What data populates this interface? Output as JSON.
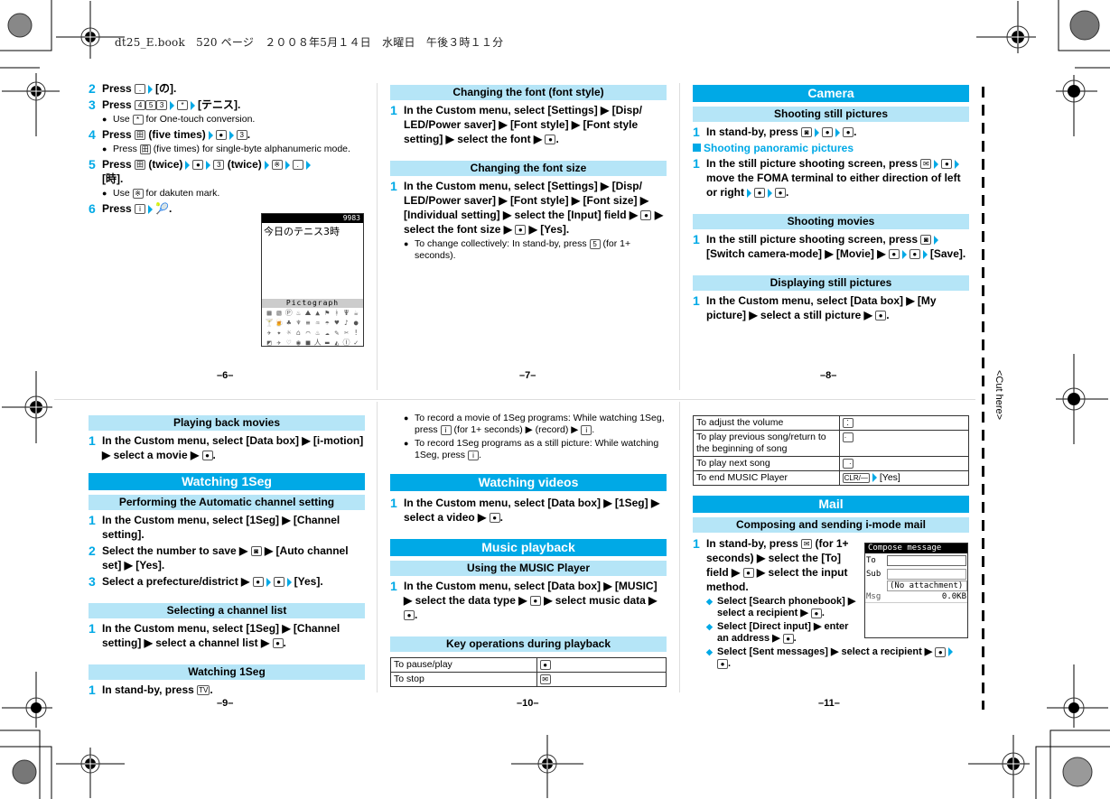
{
  "header": {
    "book_line": "dt25_E.book　520 ページ　２００８年5月１４日　水曜日　午後３時１１分"
  },
  "cut_label": "<Cut here>",
  "pages": {
    "p6": {
      "number": "–6–",
      "steps": [
        {
          "num": "2",
          "parts": [
            "Press ",
            "[.]",
            " ▶ ",
            "[の]."
          ]
        },
        {
          "num": "3",
          "parts": [
            "Press ",
            "[4][5][3]",
            " ▶ ",
            "[*]",
            " ▶ ",
            "[テニス]."
          ]
        },
        {
          "num": "4",
          "parts": [
            "Press ",
            "[田]",
            " (five times) ▶ ",
            "[●]",
            " ▶ ",
            "[3]."
          ]
        },
        {
          "num": "5",
          "parts": [
            "Press ",
            "[田]",
            " (twice) ▶ ",
            "[●]",
            " ▶ ",
            "[3]",
            " (twice) ▶ ",
            "[※]",
            " ▶ ",
            "[.]",
            " ▶ [時]."
          ]
        },
        {
          "num": "6",
          "parts": [
            "Press ",
            "[i]",
            " ▶ ",
            "🎾",
            "."
          ]
        }
      ],
      "step2": "Press",
      "step2_tail": "[の].",
      "step3": "Press",
      "step3_tail": "[テニス].",
      "step3_note": "Use",
      "step3_note_tail": "for One-touch conversion.",
      "step4": "Press",
      "step4_mid": "(five times)",
      "step4_note": "Press",
      "step4_note_tail": "(five times) for single-byte alphanumeric mode.",
      "step5": "Press",
      "step5_mid1": "(twice)",
      "step5_mid2": "(twice)",
      "step5_tail": "[時].",
      "step5_note": "Use",
      "step5_note_tail": "for dakuten mark.",
      "step6": "Press",
      "screen": {
        "counter": "9983",
        "text": "今日のテニス3時",
        "picto_title": "Pictograph"
      }
    },
    "p7": {
      "number": "–7–",
      "sec1_title": "Changing the font (font style)",
      "sec1_step": "In the Custom menu, select [Settings] ▶ [Disp/ LED/Power saver] ▶ [Font style] ▶ [Font style setting] ▶ select the font ▶",
      "sec2_title": "Changing the font size",
      "sec2_step": "In the Custom menu, select [Settings] ▶ [Disp/ LED/Power saver] ▶ [Font style] ▶ [Font size] ▶ [Individual setting] ▶ select the [Input] field ▶",
      "sec2_step_tail1": "▶ select the font size ▶",
      "sec2_step_tail2": "▶ [Yes].",
      "sec2_note": "To change collectively: In stand-by, press",
      "sec2_note_tail": "(for 1+ seconds)."
    },
    "p8": {
      "number": "–8–",
      "main_title": "Camera",
      "sec1_title": "Shooting still pictures",
      "sec1_step": "In stand-by, press",
      "pano_head": "Shooting panoramic pictures",
      "pano_step": "In the still picture shooting screen, press",
      "pano_step_mid": "move the FOMA terminal to either direction of left or right",
      "sec2_title": "Shooting movies",
      "sec2_step": "In the still picture shooting screen, press",
      "sec2_step_mid": "[Switch camera-mode] ▶ [Movie] ▶",
      "sec2_step_tail": "[Save].",
      "sec3_title": "Displaying still pictures",
      "sec3_step": "In the Custom menu, select [Data box] ▶ [My picture] ▶ select a still picture ▶"
    },
    "p9": {
      "number": "–9–",
      "sec1_title": "Playing back movies",
      "sec1_step": "In the Custom menu, select [Data box] ▶ [i-motion] ▶ select a movie ▶",
      "main_title": "Watching 1Seg",
      "sec2_title": "Performing the Automatic channel setting",
      "sec2_step1": "In the Custom menu, select [1Seg] ▶ [Channel setting].",
      "sec2_step2": "Select the number to save ▶",
      "sec2_step2_tail": "▶ [Auto channel set] ▶ [Yes].",
      "sec2_step3": "Select a prefecture/district ▶",
      "sec2_step3_tail": "[Yes].",
      "sec3_title": "Selecting a channel list",
      "sec3_step": "In the Custom menu, select [1Seg] ▶ [Channel setting] ▶ select a channel list ▶",
      "sec4_title": "Watching 1Seg",
      "sec4_step": "In stand-by, press"
    },
    "p10": {
      "number": "–10–",
      "note1": "To record a movie of 1Seg programs: While watching 1Seg, press",
      "note1_mid": "(for 1+ seconds) ▶ (record) ▶",
      "note2": "To record 1Seg programs as a still picture: While watching 1Seg, press",
      "main1_title": "Watching videos",
      "main1_step": "In the Custom menu, select [Data box] ▶ [1Seg] ▶ select a video ▶",
      "main2_title": "Music playback",
      "sec1_title": "Using the MUSIC Player",
      "sec1_step": "In the Custom menu, select [Data box] ▶ [MUSIC] ▶ select the data type ▶",
      "sec1_step_mid": "▶ select music data ▶",
      "sec2_title": "Key operations during playback",
      "ops": [
        {
          "action": "To pause/play",
          "key": "●"
        },
        {
          "action": "To stop",
          "key": "✉"
        }
      ]
    },
    "p11": {
      "number": "–11–",
      "ops": [
        {
          "action": "To adjust the volume",
          "key": "⁚"
        },
        {
          "action": "To play previous song/return to the beginning of song",
          "key": "·"
        },
        {
          "action": "To play next song",
          "key": "·"
        },
        {
          "action": "To end MUSIC Player",
          "key": "CLR/—",
          "tail": "[Yes]"
        }
      ],
      "main_title": "Mail",
      "sec1_title": "Composing and sending i-mode mail",
      "step": "In stand-by, press",
      "step_mid": "(for 1+ seconds) ▶ select the [To] field ▶",
      "step_tail": "▶ select the input method.",
      "sub1": "Select [Search phonebook] ▶ select a recipient ▶",
      "sub2": "Select [Direct input] ▶ enter an address ▶",
      "sub3": "Select [Sent messages] ▶ select a recipient ▶",
      "screen": {
        "title": "Compose message",
        "to_label": "To",
        "sub_label": "Sub",
        "attachment": "(No attachment)",
        "msg_label": "Msg",
        "size": "0.0KB"
      }
    }
  }
}
